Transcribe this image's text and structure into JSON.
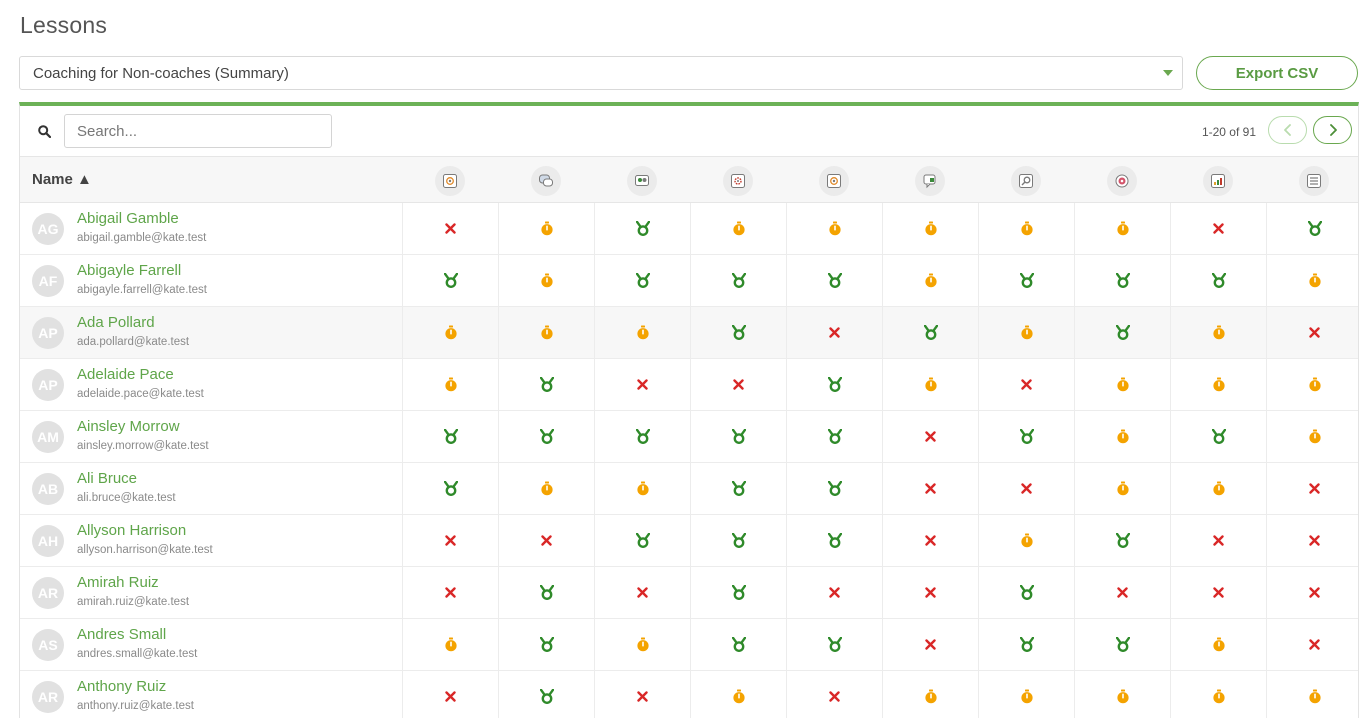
{
  "page": {
    "title": "Lessons"
  },
  "lesson_select": {
    "value": "Coaching for Non-coaches (Summary)"
  },
  "export_button": {
    "label": "Export CSV"
  },
  "search": {
    "placeholder": "Search..."
  },
  "pagination": {
    "range_text": "1-20 of 91"
  },
  "table": {
    "name_header": "Name ▲",
    "columns": [
      {
        "icon": "target-icon"
      },
      {
        "icon": "chat-icon"
      },
      {
        "icon": "team-icon"
      },
      {
        "icon": "gear-icon"
      },
      {
        "icon": "target-icon"
      },
      {
        "icon": "feedback-icon"
      },
      {
        "icon": "search-icon"
      },
      {
        "icon": "goal-icon"
      },
      {
        "icon": "chart-icon"
      },
      {
        "icon": "list-icon"
      }
    ],
    "status_legend": {
      "x": "not-started",
      "t": "in-progress",
      "m": "completed"
    },
    "colors": {
      "x": "#d92727",
      "t": "#f4a300",
      "m": "#2f8a2a",
      "accent": "#6aa84f"
    },
    "rows": [
      {
        "initials": "AG",
        "name": "Abigail Gamble",
        "email": "abigail.gamble@kate.test",
        "statuses": [
          "x",
          "t",
          "m",
          "t",
          "t",
          "t",
          "t",
          "t",
          "x",
          "m"
        ]
      },
      {
        "initials": "AF",
        "name": "Abigayle Farrell",
        "email": "abigayle.farrell@kate.test",
        "statuses": [
          "m",
          "t",
          "m",
          "m",
          "m",
          "t",
          "m",
          "m",
          "m",
          "t"
        ]
      },
      {
        "initials": "AP",
        "name": "Ada Pollard",
        "email": "ada.pollard@kate.test",
        "statuses": [
          "t",
          "t",
          "t",
          "m",
          "x",
          "m",
          "t",
          "m",
          "t",
          "x"
        ]
      },
      {
        "initials": "AP",
        "name": "Adelaide Pace",
        "email": "adelaide.pace@kate.test",
        "statuses": [
          "t",
          "m",
          "x",
          "x",
          "m",
          "t",
          "x",
          "t",
          "t",
          "t"
        ]
      },
      {
        "initials": "AM",
        "name": "Ainsley Morrow",
        "email": "ainsley.morrow@kate.test",
        "statuses": [
          "m",
          "m",
          "m",
          "m",
          "m",
          "x",
          "m",
          "t",
          "m",
          "t"
        ]
      },
      {
        "initials": "AB",
        "name": "Ali Bruce",
        "email": "ali.bruce@kate.test",
        "statuses": [
          "m",
          "t",
          "t",
          "m",
          "m",
          "x",
          "x",
          "t",
          "t",
          "x"
        ]
      },
      {
        "initials": "AH",
        "name": "Allyson Harrison",
        "email": "allyson.harrison@kate.test",
        "statuses": [
          "x",
          "x",
          "m",
          "m",
          "m",
          "x",
          "t",
          "m",
          "x",
          "x"
        ]
      },
      {
        "initials": "AR",
        "name": "Amirah Ruiz",
        "email": "amirah.ruiz@kate.test",
        "statuses": [
          "x",
          "m",
          "x",
          "m",
          "x",
          "x",
          "m",
          "x",
          "x",
          "x"
        ]
      },
      {
        "initials": "AS",
        "name": "Andres Small",
        "email": "andres.small@kate.test",
        "statuses": [
          "t",
          "m",
          "t",
          "m",
          "m",
          "x",
          "m",
          "m",
          "t",
          "x"
        ]
      },
      {
        "initials": "AR",
        "name": "Anthony Ruiz",
        "email": "anthony.ruiz@kate.test",
        "statuses": [
          "x",
          "m",
          "x",
          "t",
          "x",
          "t",
          "t",
          "t",
          "t",
          "t"
        ]
      }
    ]
  }
}
